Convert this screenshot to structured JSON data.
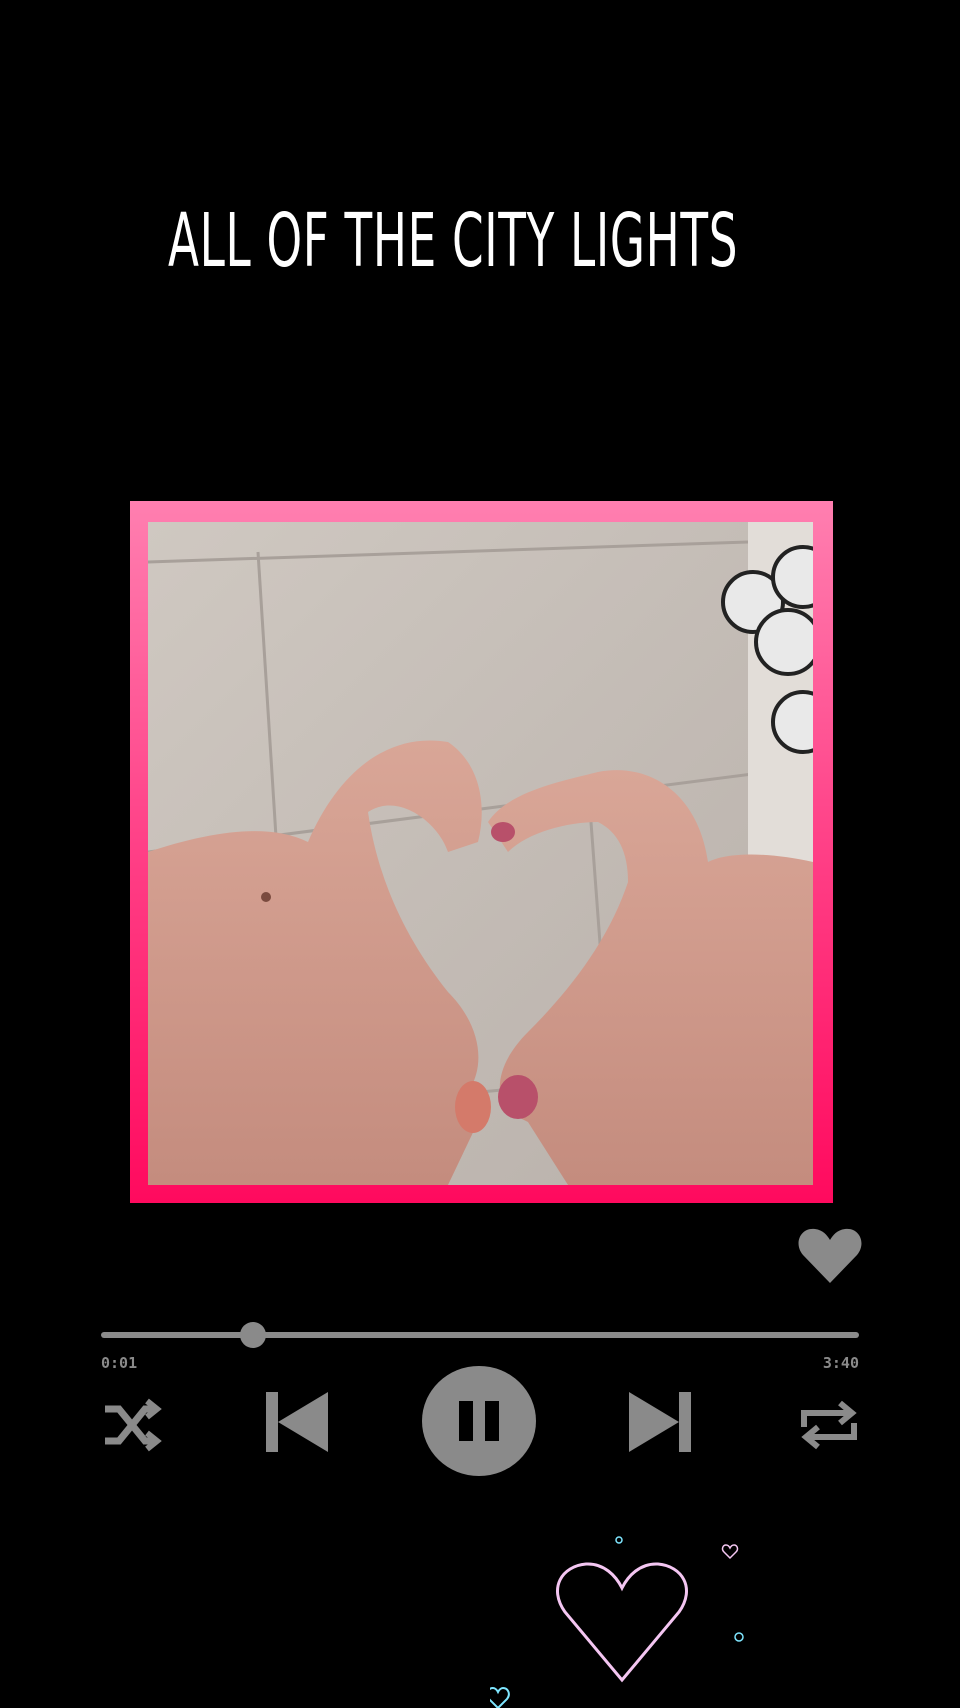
{
  "song": {
    "title": "ALL OF THE CITY LIGHTS"
  },
  "player": {
    "elapsed": "0:01",
    "total": "3:40",
    "progress": 0.2,
    "liked": true
  },
  "colors": {
    "background": "#000000",
    "frame_top": "#ff7fb0",
    "frame_bottom": "#ff0a5e",
    "controls": "#8a8a8a",
    "heart_outline": "#f4c6f2",
    "small_hearts": "#7fe6ff"
  },
  "icons": {
    "like": "heart-icon",
    "shuffle": "shuffle-icon",
    "previous": "skip-previous-icon",
    "pause": "pause-icon",
    "next": "skip-next-icon",
    "repeat": "repeat-icon"
  }
}
